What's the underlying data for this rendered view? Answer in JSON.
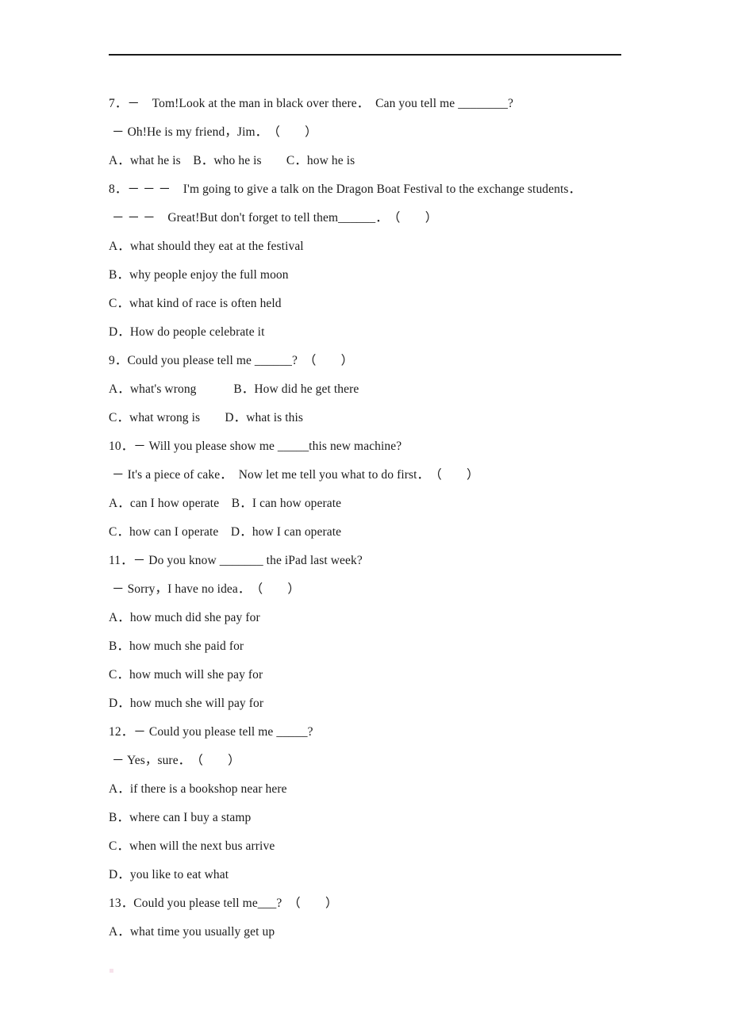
{
  "page": {
    "background_color": "#ffffff",
    "text_color": "#1a1a1a",
    "rule_color": "#1a1a1a"
  },
  "lines": [
    {
      "id": "q7-stem",
      "text": "7．－　Tom!Look at the man in black over there．　Can you tell me ________?"
    },
    {
      "id": "q7-reply",
      "text": "－ Oh!He is my friend，Jim．　（　　）"
    },
    {
      "id": "q7-options",
      "text": "A．what he is　B．who he is　　C．how he is"
    },
    {
      "id": "q8-stem",
      "text": "8．－ － －　I'm going to give a talk on the Dragon Boat Festival to the exchange students．"
    },
    {
      "id": "q8-reply",
      "text": "－ － －　Great!But don't forget to tell them______．　（　　）"
    },
    {
      "id": "q8-optA",
      "text": "A．what should they eat at the festival"
    },
    {
      "id": "q8-optB",
      "text": "B．why people enjoy the full moon"
    },
    {
      "id": "q8-optC",
      "text": "C．what kind of race is often held"
    },
    {
      "id": "q8-optD",
      "text": "D．How do people celebrate it"
    },
    {
      "id": "q9-stem",
      "text": "9．Could you please tell me ______?　（　　）"
    },
    {
      "id": "q9-optAB",
      "text": "A．what's wrong　　　B．How did he get there"
    },
    {
      "id": "q9-optCD",
      "text": "C．what wrong is　　D．what is this"
    },
    {
      "id": "q10-stem",
      "text": "10．－ Will you please show me _____this new machine?"
    },
    {
      "id": "q10-reply",
      "text": "－ It's a piece of cake．　Now let me tell you what to do first．　（　　）"
    },
    {
      "id": "q10-optAB",
      "text": "A．can I how operate　B．I can how operate"
    },
    {
      "id": "q10-optCD",
      "text": "C．how can I operate　D．how I can operate"
    },
    {
      "id": "q11-stem",
      "text": "11．－ Do you know _______ the iPad last week?"
    },
    {
      "id": "q11-reply",
      "text": "－ Sorry，I have no idea．　（　　）"
    },
    {
      "id": "q11-optA",
      "text": "A．how much did she pay for"
    },
    {
      "id": "q11-optB",
      "text": "B．how much she paid for"
    },
    {
      "id": "q11-optC",
      "text": "C．how much will she pay for"
    },
    {
      "id": "q11-optD",
      "text": "D．how much she will pay for"
    },
    {
      "id": "q12-stem",
      "text": "12．－ Could you please tell me _____?"
    },
    {
      "id": "q12-reply",
      "text": "－ Yes，sure．　（　　）"
    },
    {
      "id": "q12-optA",
      "text": "A．if there is a bookshop near here"
    },
    {
      "id": "q12-optB",
      "text": "B．where can I buy a stamp"
    },
    {
      "id": "q12-optC",
      "text": "C．when will the next bus arrive"
    },
    {
      "id": "q12-optD",
      "text": "D．you like to eat what"
    },
    {
      "id": "q13-stem",
      "text": "13．Could you please tell me___?　（　　）"
    },
    {
      "id": "q13-optA",
      "text": "A．what time you usually get up"
    }
  ]
}
